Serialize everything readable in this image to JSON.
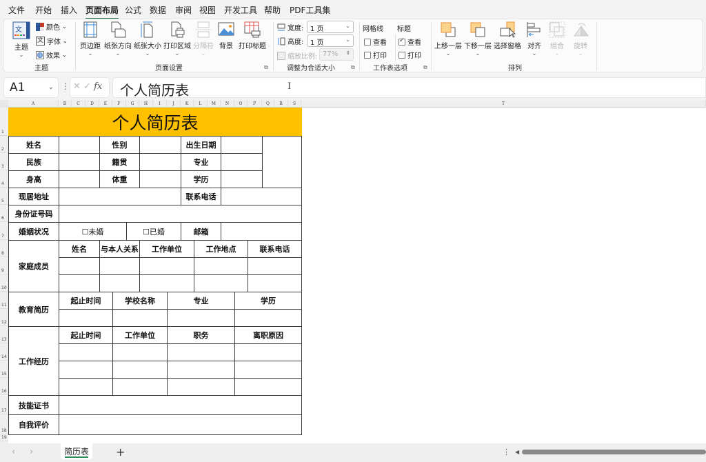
{
  "menu": {
    "tabs": [
      "文件",
      "开始",
      "插入",
      "页面布局",
      "公式",
      "数据",
      "审阅",
      "视图",
      "开发工具",
      "帮助",
      "PDF工具集"
    ],
    "active": "页面布局"
  },
  "ribbon": {
    "theme_group": {
      "label": "主题",
      "theme_button": "主题",
      "colors": "颜色",
      "fonts": "字体",
      "effects": "效果"
    },
    "page_setup_group": {
      "label": "页面设置",
      "margins": "页边距",
      "orientation": "纸张方向",
      "size": "纸张大小",
      "print_area": "打印区域",
      "breaks": "分隔符",
      "background": "背景",
      "print_titles": "打印标题"
    },
    "scale_group": {
      "label": "调整为合适大小",
      "width_label": "宽度:",
      "width_value": "1 页",
      "height_label": "高度:",
      "height_value": "1 页",
      "scale_label": "缩放比例:",
      "scale_value": "77%"
    },
    "sheet_options_group": {
      "label": "工作表选项",
      "gridlines_title": "网格线",
      "headings_title": "标题",
      "view": "查看",
      "print": "打印",
      "gridlines_view_checked": false,
      "gridlines_print_checked": false,
      "headings_view_checked": true,
      "headings_print_checked": false
    },
    "arrange_group": {
      "label": "排列",
      "bring_forward": "上移一层",
      "send_backward": "下移一层",
      "selection_pane": "选择窗格",
      "align": "对齐",
      "group": "组合",
      "rotate": "旋转"
    }
  },
  "formula_bar": {
    "name_box": "A1",
    "fx": "fx",
    "content": "个人简历表"
  },
  "grid": {
    "columns": [
      "A",
      "B",
      "C",
      "D",
      "E",
      "F",
      "G",
      "H",
      "I",
      "J",
      "K",
      "L",
      "M",
      "N",
      "O",
      "P",
      "Q",
      "R",
      "S",
      "T"
    ],
    "rows": [
      "1",
      "2",
      "3",
      "4",
      "5",
      "6",
      "7",
      "8",
      "9",
      "10",
      "11",
      "12",
      "13",
      "14",
      "15",
      "16",
      "17",
      "18",
      "19"
    ]
  },
  "form": {
    "title": "个人简历表",
    "basic": {
      "name": "姓名",
      "gender": "性别",
      "birth_date": "出生日期",
      "ethnicity": "民族",
      "native_place": "籍贯",
      "major": "专业",
      "height": "身高",
      "weight": "体重",
      "education": "学历",
      "address": "现居地址",
      "phone": "联系电话",
      "id_number": "身份证号码",
      "marital_status": "婚姻状况",
      "unmarried": "☐未婚",
      "married": "☐已婚",
      "email": "邮箱"
    },
    "family": {
      "label": "家庭成员",
      "headers": [
        "姓名",
        "与本人关系",
        "工作单位",
        "工作地点",
        "联系电话"
      ]
    },
    "education_history": {
      "label": "教育简历",
      "headers": [
        "起止时间",
        "学校名称",
        "专业",
        "学历"
      ]
    },
    "work_history": {
      "label": "工作经历",
      "headers": [
        "起止时间",
        "工作单位",
        "职务",
        "离职原因"
      ]
    },
    "skills": "技能证书",
    "self_evaluation": "自我评价"
  },
  "sheet_tabs": {
    "tabs": [
      "简历表"
    ],
    "active": "简历表",
    "add": "+"
  }
}
